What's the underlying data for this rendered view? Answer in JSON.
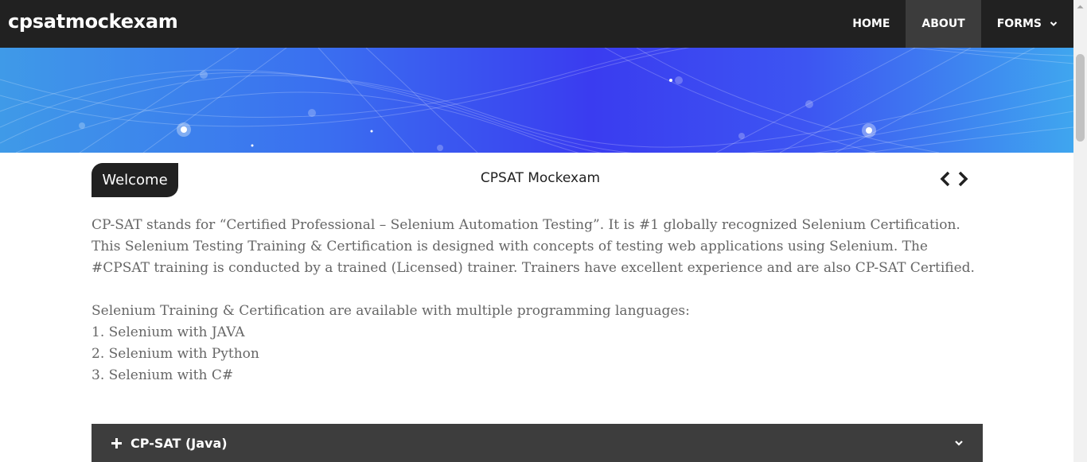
{
  "navbar": {
    "brand": "cpsatmockexam",
    "items": [
      {
        "label": "HOME"
      },
      {
        "label": "ABOUT"
      },
      {
        "label": "FORMS"
      }
    ]
  },
  "welcome": {
    "tab_label": "Welcome",
    "carousel_title": "CPSAT Mockexam"
  },
  "content": {
    "paragraph1": "CP-SAT stands for “Certified Professional – Selenium Automation Testing”. It is #1 globally recognized Selenium Certification. This Selenium Testing Training & Certification is designed with concepts of testing web applications using Selenium. The #CPSAT training is conducted by a trained (Licensed) trainer. Trainers have excellent experience and are also CP-SAT Certified.",
    "intro": "Selenium Training & Certification are available with multiple programming languages:",
    "languages": [
      "1. Selenium with JAVA",
      "2. Selenium with Python",
      "3. Selenium with C#"
    ]
  },
  "accordion": {
    "title": "CP-SAT (Java)"
  }
}
